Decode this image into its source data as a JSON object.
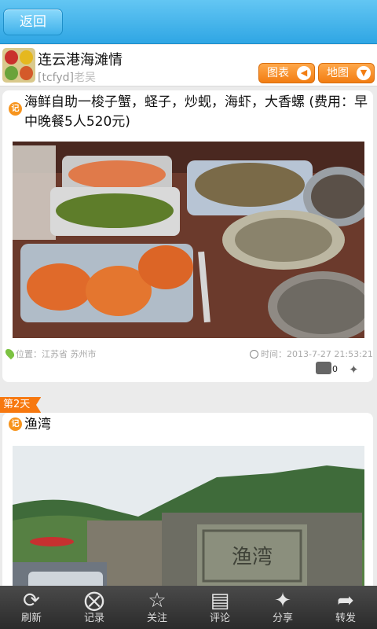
{
  "topbar": {
    "back_label": "返回"
  },
  "trip": {
    "title": "连云港海滩情",
    "author_id": "[tcfyd]",
    "author_name": "老吴",
    "chart_button": "图表",
    "map_button": "地图"
  },
  "entries": [
    {
      "badge": "记",
      "text": "海鲜自助一梭子蟹，蛏子，炒蚬，海虾，大香螺 (费用：早中晚餐5人520元)",
      "location": "位置：江苏省 苏州市",
      "time": "时间：2013-7-27 21:53:21",
      "comment_count": "0"
    },
    {
      "badge": "记",
      "text": "渔湾",
      "stone_text": "渔湾"
    }
  ],
  "day_label": "第2天",
  "toolbar": [
    {
      "label": "刷新",
      "icon": "refresh-icon"
    },
    {
      "label": "记录",
      "icon": "record-icon"
    },
    {
      "label": "关注",
      "icon": "star-icon"
    },
    {
      "label": "评论",
      "icon": "comment-icon"
    },
    {
      "label": "分享",
      "icon": "share-icon"
    },
    {
      "label": "转发",
      "icon": "forward-icon"
    }
  ]
}
